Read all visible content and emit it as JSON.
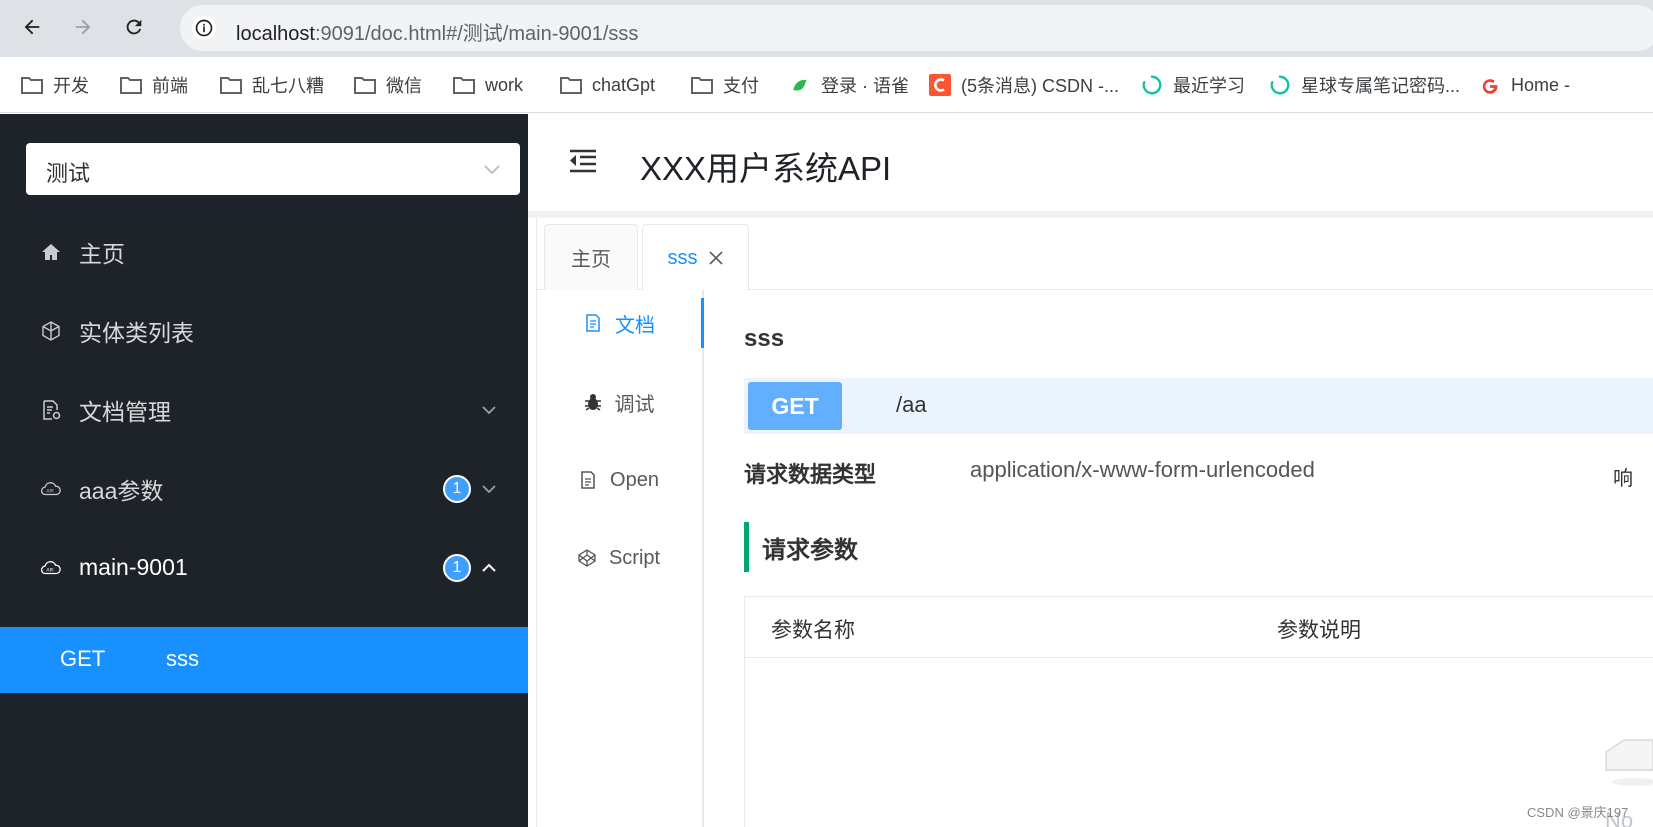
{
  "browser": {
    "url_host": "localhost",
    "url_rest": ":9091/doc.html#/测试/main-9001/sss",
    "bookmarks": [
      {
        "label": "开发",
        "icon": "folder-icon"
      },
      {
        "label": "前端",
        "icon": "folder-icon"
      },
      {
        "label": "乱七八糟",
        "icon": "folder-icon"
      },
      {
        "label": "微信",
        "icon": "folder-icon"
      },
      {
        "label": "work",
        "icon": "folder-icon"
      },
      {
        "label": "chatGpt",
        "icon": "folder-icon"
      },
      {
        "label": "支付",
        "icon": "folder-icon"
      },
      {
        "label": "登录 · 语雀",
        "icon": "yuque-icon"
      },
      {
        "label": "(5条消息) CSDN -...",
        "icon": "csdn-icon"
      },
      {
        "label": "最近学习",
        "icon": "loading-ring-icon"
      },
      {
        "label": "星球专属笔记密码...",
        "icon": "loading-ring-icon"
      },
      {
        "label": "Home -",
        "icon": "google-icon"
      }
    ]
  },
  "sidebar": {
    "group_select": "测试",
    "items": [
      {
        "label": "主页",
        "icon": "home-icon"
      },
      {
        "label": "实体类列表",
        "icon": "cube-icon"
      },
      {
        "label": "文档管理",
        "icon": "doc-settings-icon"
      },
      {
        "label": "aaa参数",
        "icon": "api-cloud-icon",
        "badge": "1"
      },
      {
        "label": "main-9001",
        "icon": "api-cloud-icon",
        "badge": "1"
      }
    ],
    "sub_item": {
      "method": "GET",
      "name": "sss"
    }
  },
  "header": {
    "title": "XXX用户系统API"
  },
  "tabs": {
    "home": "主页",
    "active": "sss"
  },
  "side_tabs": [
    "文档",
    "调试",
    "Open",
    "Script"
  ],
  "doc": {
    "title": "sss",
    "method": "GET",
    "path": "/aa",
    "req_type_label": "请求数据类型",
    "req_type_value": "application/x-www-form-urlencoded",
    "edge_glyph": "响",
    "section_title": "请求参数",
    "columns": [
      "参数名称",
      "参数说明"
    ],
    "nodata": "No D"
  },
  "watermark": "CSDN @景庆197",
  "colors": {
    "sidebar_bg": "#1d2328",
    "active_blue": "#1890ff",
    "get_tag": "#61affe",
    "section_bar": "#00a86b"
  }
}
